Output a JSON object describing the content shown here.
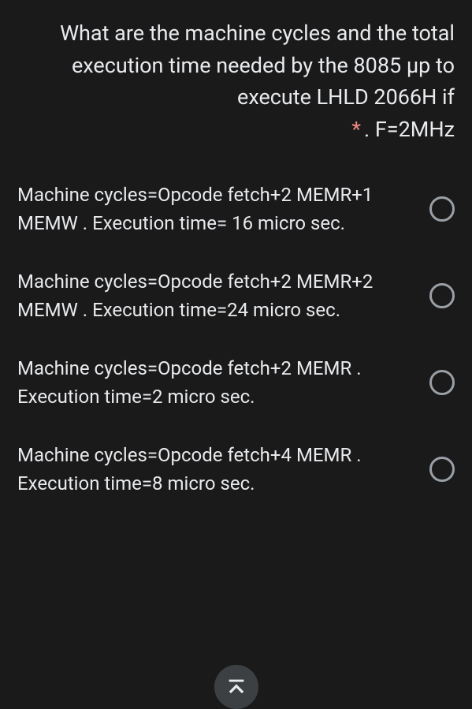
{
  "question": {
    "main": "What are the machine cycles and the total execution time needed by the 8085 µp to execute LHLD 2066H if",
    "suffix": ". F=2MHz",
    "required_marker": "*"
  },
  "options": [
    {
      "label": "Machine cycles=Opcode fetch+2 MEMR+1 MEMW . Execution time= 16 micro sec."
    },
    {
      "label": "Machine cycles=Opcode fetch+2 MEMR+2 MEMW . Execution time=24 micro sec."
    },
    {
      "label": "Machine cycles=Opcode fetch+2 MEMR . Execution time=2 micro sec."
    },
    {
      "label": "Machine cycles=Opcode fetch+4 MEMR . Execution time=8 micro sec."
    }
  ]
}
